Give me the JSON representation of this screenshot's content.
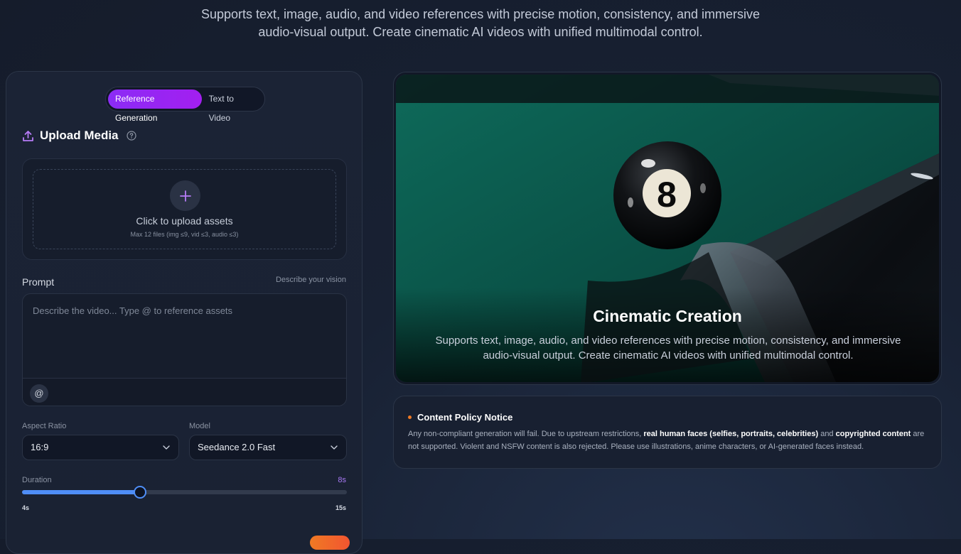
{
  "hero": {
    "subtitle_line1": "Supports text, image, audio, and video references with precise motion, consistency, and immersive",
    "subtitle_line2": "audio-visual output. Create cinematic AI videos with unified multimodal control."
  },
  "mode_toggle": {
    "options": [
      "Reference Generation",
      "Text to Video"
    ],
    "active": "Reference Generation"
  },
  "upload": {
    "title": "Upload Media",
    "cta": "Click to upload assets",
    "hint": "Max 12 files (img ≤9, vid ≤3, audio ≤3)"
  },
  "prompt": {
    "label": "Prompt",
    "aside": "Describe your vision",
    "placeholder": "Describe the video... Type @ to reference assets",
    "at_button": "@"
  },
  "aspect_ratio": {
    "label": "Aspect Ratio",
    "value": "16:9"
  },
  "model": {
    "label": "Model",
    "value": "Seedance 2.0 Fast"
  },
  "duration": {
    "label": "Duration",
    "value_label": "8s",
    "min_label": "4s",
    "max_label": "15s",
    "min": 4,
    "max": 15,
    "value": 8
  },
  "preview": {
    "title": "Cinematic Creation",
    "subtitle_line1": "Supports text, image, audio, and video references with precise motion, consistency, and immersive",
    "subtitle_line2": "audio-visual output. Create cinematic AI videos with unified multimodal control.",
    "ball_number": "8"
  },
  "notice": {
    "title": "Content Policy Notice",
    "body_1": "Any non-compliant generation will fail. Due to upstream restrictions, ",
    "bold_1": "real human faces (selfies, portraits, celebrities)",
    "body_2": " and ",
    "bold_2": "copyrighted content",
    "body_3": " are not supported. Violent and NSFW content is also rejected. Please use illustrations, anime characters, or AI-generated faces instead."
  },
  "colors": {
    "accent_purple": "#9b24f2",
    "slider_blue": "#4f8ef7",
    "notice_dot": "#f07a24"
  }
}
